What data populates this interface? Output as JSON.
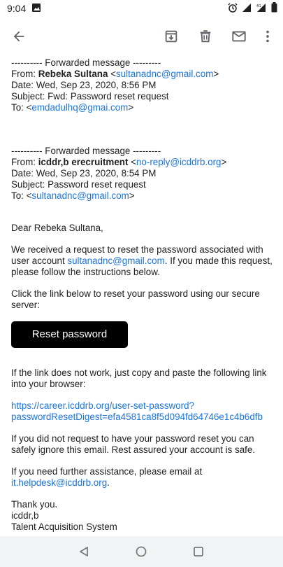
{
  "status_bar": {
    "time": "9:04"
  },
  "toolbar": {
    "icons": [
      "back-arrow-icon",
      "archive-icon",
      "delete-icon",
      "mark-unread-icon",
      "more-vert-icon"
    ]
  },
  "email": {
    "fwd1": {
      "header": "---------- Forwarded message ---------",
      "from_label": "From: ",
      "from_name": "Rebeka Sultana",
      "from_email": "sultanadnc@gmail.com",
      "date": "Date: Wed, Sep 23, 2020, 8:56 PM",
      "subject": "Subject: Fwd: Password reset request",
      "to_label": "To: ",
      "to_email": "emdadulhq@gmai.com"
    },
    "fwd2": {
      "header": "---------- Forwarded message ---------",
      "from_label": "From: ",
      "from_name": "icddr,b erecruitment",
      "from_email": "no-reply@icddrb.org",
      "date": "Date: Wed, Sep 23, 2020, 8:54 PM",
      "subject": "Subject: Password reset request",
      "to_label": "To: ",
      "to_email": "sultanadnc@gmail.com"
    },
    "greeting": "Dear Rebeka Sultana,",
    "para1_a": "We received a request to reset the password associated with user account ",
    "para1_link": "sultanadnc@gmail.com",
    "para1_b": ". If you made this request, please follow the instructions below.",
    "para2": "Click the link below to reset your password using our secure server:",
    "reset_button": "Reset password",
    "para3": "If the link does not work, just copy and paste the following link into your browser:",
    "reset_link_line1": "https://career.icddrb.org/user-set-password?",
    "reset_link_line2": "passwordResetDigest=efa4581ca8f5d094fd64746e1c4b6dfb",
    "para4": "If you did not request to have your password reset you can safely ignore this email. Rest assured your account is safe.",
    "para5_a": "If you need further assistance, please email at ",
    "para5_link": "it.helpdesk@icddrb.org",
    "para5_b": ".",
    "sign1": "Thank you.",
    "sign2": "icddr,b",
    "sign3": "Talent Acquisition System"
  },
  "colors": {
    "link": "#1a73e8",
    "button_bg": "#000000",
    "icon": "#5f6368"
  }
}
